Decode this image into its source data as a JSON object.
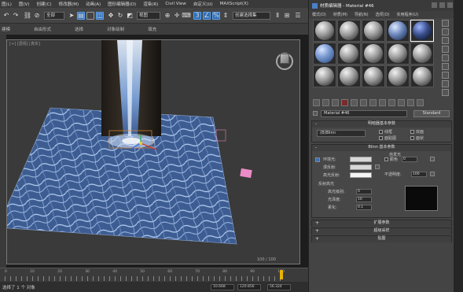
{
  "menubar": {
    "items": [
      "图(L)",
      "图(V)",
      "创建(C)",
      "修改器(M)",
      "动画(A)",
      "图形编辑器(D)",
      "渲染(R)",
      "Civil View",
      "自定义(U)",
      "MAXScript(X)"
    ]
  },
  "toolbar": {
    "filter_value": "全部",
    "view_value": "视图",
    "selection_set_value": "创建选择集"
  },
  "ribbon": {
    "items": [
      "建模",
      "自由形式",
      "选择",
      "对象绘制",
      "填充"
    ]
  },
  "viewport": {
    "label": "[+] [透视] [真实]",
    "frame_counter": "100 / 100"
  },
  "timeline": {
    "ticks": [
      "0",
      "10",
      "20",
      "30",
      "40",
      "50",
      "60",
      "70",
      "80",
      "90",
      "100"
    ]
  },
  "statusbar": {
    "selection_text": "选择了 1 个 对象",
    "x_value": "10.668",
    "y_value": "120.856",
    "z_value": "56.324"
  },
  "material_editor": {
    "title": "材质编辑器 - Material #46",
    "menu": [
      "模式(D)",
      "材质(M)",
      "导航(N)",
      "选项(O)",
      "实用程序(U)"
    ],
    "slot_spheres": [
      "grey",
      "grey",
      "grey",
      "blue",
      "dark",
      "water",
      "grey",
      "grey",
      "grey",
      "grey",
      "grey",
      "grey",
      "grey",
      "grey",
      "grey"
    ],
    "selected_slot": 4,
    "material_name": "Material #46",
    "material_type": "Standard",
    "shader_rollout": {
      "title": "明暗器基本参数",
      "shader_value": "(B)Blinn",
      "options": [
        "线框",
        "双面",
        "面贴图",
        "面状"
      ]
    },
    "blinn_rollout": {
      "title": "Blinn 基本参数",
      "self_illum_title": "自发光",
      "color_label": "颜色",
      "color_value": "0",
      "ambient_label": "环境光:",
      "diffuse_label": "漫反射:",
      "specular_label": "高光反射:",
      "opacity_label": "不透明度:",
      "opacity_value": "100",
      "specular_highlights_title": "反射高光",
      "specular_level_label": "高光级别:",
      "specular_level_value": "0",
      "glossiness_label": "光泽度:",
      "glossiness_value": "10",
      "soften_label": "柔化:",
      "soften_value": "0.1"
    },
    "extra_rollouts": [
      "扩展参数",
      "超级采样",
      "贴图"
    ]
  }
}
